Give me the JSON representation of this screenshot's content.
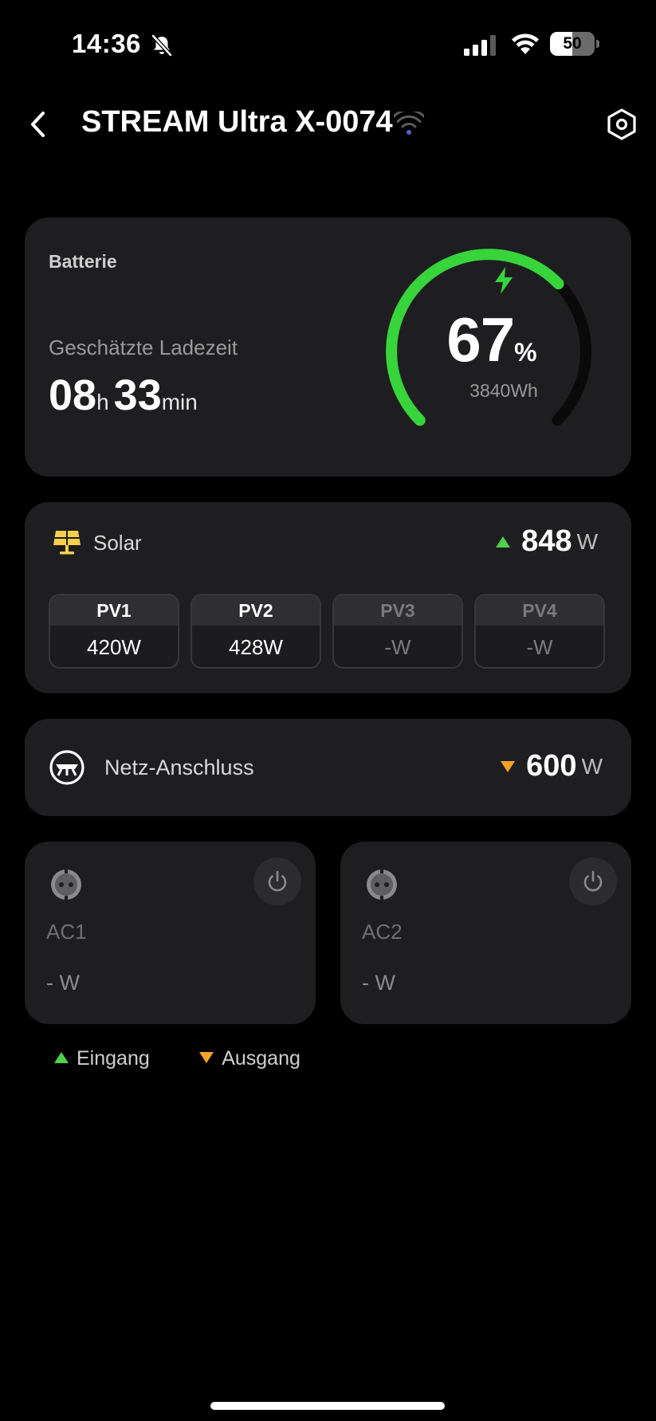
{
  "status_bar": {
    "time": "14:36",
    "battery_level": "50",
    "icons": [
      "bell-slash-icon",
      "cellular-signal-icon",
      "wifi-icon",
      "battery-icon"
    ]
  },
  "header": {
    "title": "STREAM Ultra X-0074",
    "icons": [
      "chevron-left-icon",
      "wifi-icon",
      "hexagon-gear-icon"
    ]
  },
  "battery": {
    "label": "Batterie",
    "eta_label": "Geschätzte Ladezeit",
    "eta_hours": "08",
    "eta_hours_unit": "h",
    "eta_minutes": "33",
    "eta_minutes_unit": "min",
    "percent": "67",
    "percent_symbol": "%",
    "percent_value": 67,
    "capacity": "3840Wh",
    "gauge_color": "#37d43b"
  },
  "solar": {
    "title": "Solar",
    "power": "848",
    "unit": "W",
    "direction": "input",
    "panels": [
      {
        "name": "PV1",
        "value": "420W",
        "active": true
      },
      {
        "name": "PV2",
        "value": "428W",
        "active": true
      },
      {
        "name": "PV3",
        "value": "-W",
        "active": false
      },
      {
        "name": "PV4",
        "value": "-W",
        "active": false
      }
    ]
  },
  "grid": {
    "title": "Netz-Anschluss",
    "power": "600",
    "unit": "W",
    "direction": "output"
  },
  "ac_outputs": [
    {
      "name": "AC1",
      "value": "- W"
    },
    {
      "name": "AC2",
      "value": "- W"
    }
  ],
  "legend": {
    "input_label": "Eingang",
    "output_label": "Ausgang"
  },
  "colors": {
    "input": "#4fd04a",
    "output": "#f3a22a",
    "solar_icon": "#f5d04a",
    "card_bg": "#1e1e20",
    "wifi_connected": "#4a63d8"
  }
}
